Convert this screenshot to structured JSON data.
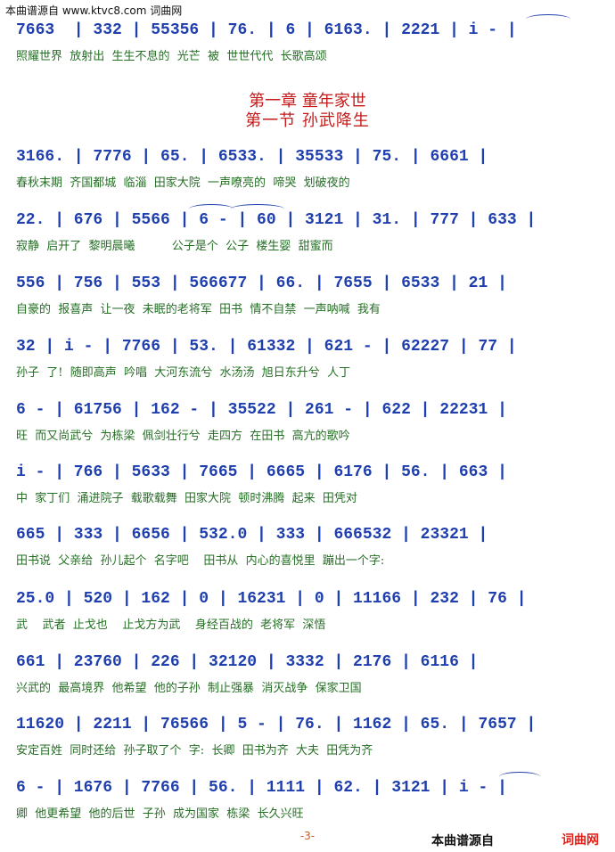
{
  "header": {
    "text": "本曲谱源自 www.ktvc8.com 词曲网"
  },
  "chapter": {
    "title": "第一章  童年家世",
    "section": "第一节  孙武降生"
  },
  "rows": [
    {
      "notes": "7663  | 332 | 55356 | 76. | 6 | 6163. | 2221 | i - |",
      "lyrics": "照耀世界  放射出  生生不息的  光芒  被  世世代代  长歌高颂"
    },
    {
      "notes": "3166. | 7776 | 65. | 6533. | 35533 | 75. | 6661 |",
      "lyrics": "春秋末期  齐国都城  临淄  田家大院  一声嘹亮的  啼哭  划破夜的"
    },
    {
      "notes": "22. | 676 | 5566 | 6 - | 60 | 3121 | 31. | 777 | 633 |",
      "lyrics": "寂静  启开了  黎明晨曦          公子是个  公子  楼生婴  甜蜜而"
    },
    {
      "notes": "556 | 756 | 553 | 566677 | 66. | 7655 | 6533 | 21 |",
      "lyrics": "自豪的  报喜声  让一夜  未眠的老将军  田书  情不自禁  一声呐喊  我有"
    },
    {
      "notes": "32 | i - | 7766 | 53. | 61332 | 621 - | 62227 | 77 |",
      "lyrics": "孙子  了!  随即高声  吟唱  大河东流兮  水汤汤  旭日东升兮  人丁"
    },
    {
      "notes": "6 - | 61756 | 162 - | 35522 | 261 - | 622 | 22231 |",
      "lyrics": "旺  而又尚武兮  为栋梁  佩剑壮行兮  走四方  在田书  高亢的歌吟"
    },
    {
      "notes": "i - | 766 | 5633 | 7665 | 6665 | 6176 | 56. | 663 |",
      "lyrics": "中  家丁们  涌进院子  载歌载舞  田家大院  顿时沸腾  起来  田凭对"
    },
    {
      "notes": "665 | 333 | 6656 | 532.0 | 333 | 666532 | 23321 |",
      "lyrics": "田书说  父亲给  孙儿起个  名字吧    田书从  内心的喜悦里  蹦出一个字:"
    },
    {
      "notes": "25.0 | 520 | 162 | 0 | 16231 | 0 | 11166 | 232 | 76 |",
      "lyrics": "武    武者  止戈也    止戈方为武    身经百战的  老将军  深悟"
    },
    {
      "notes": "661 | 23760 | 226 | 32120 | 3332 | 2176 | 6116 |",
      "lyrics": "兴武的  最高境界  他希望  他的子孙  制止强暴  消灭战争  保家卫国"
    },
    {
      "notes": "11620 | 2211 | 76566 | 5 - | 76. | 1162 | 65. | 7657 |",
      "lyrics": "安定百姓  同时还给  孙子取了个  字:  长卿  田书为齐  大夫  田凭为齐"
    },
    {
      "notes": "6 - | 1676 | 7766 | 56. | 1111 | 62. | 3121 | i - |",
      "lyrics": "卿  他更希望  他的后世  子孙  成为国家  栋梁  长久兴旺"
    }
  ],
  "footer": {
    "page_number": "-3-",
    "watermark_left": "本曲谱源自",
    "watermark_right": "词曲网"
  }
}
